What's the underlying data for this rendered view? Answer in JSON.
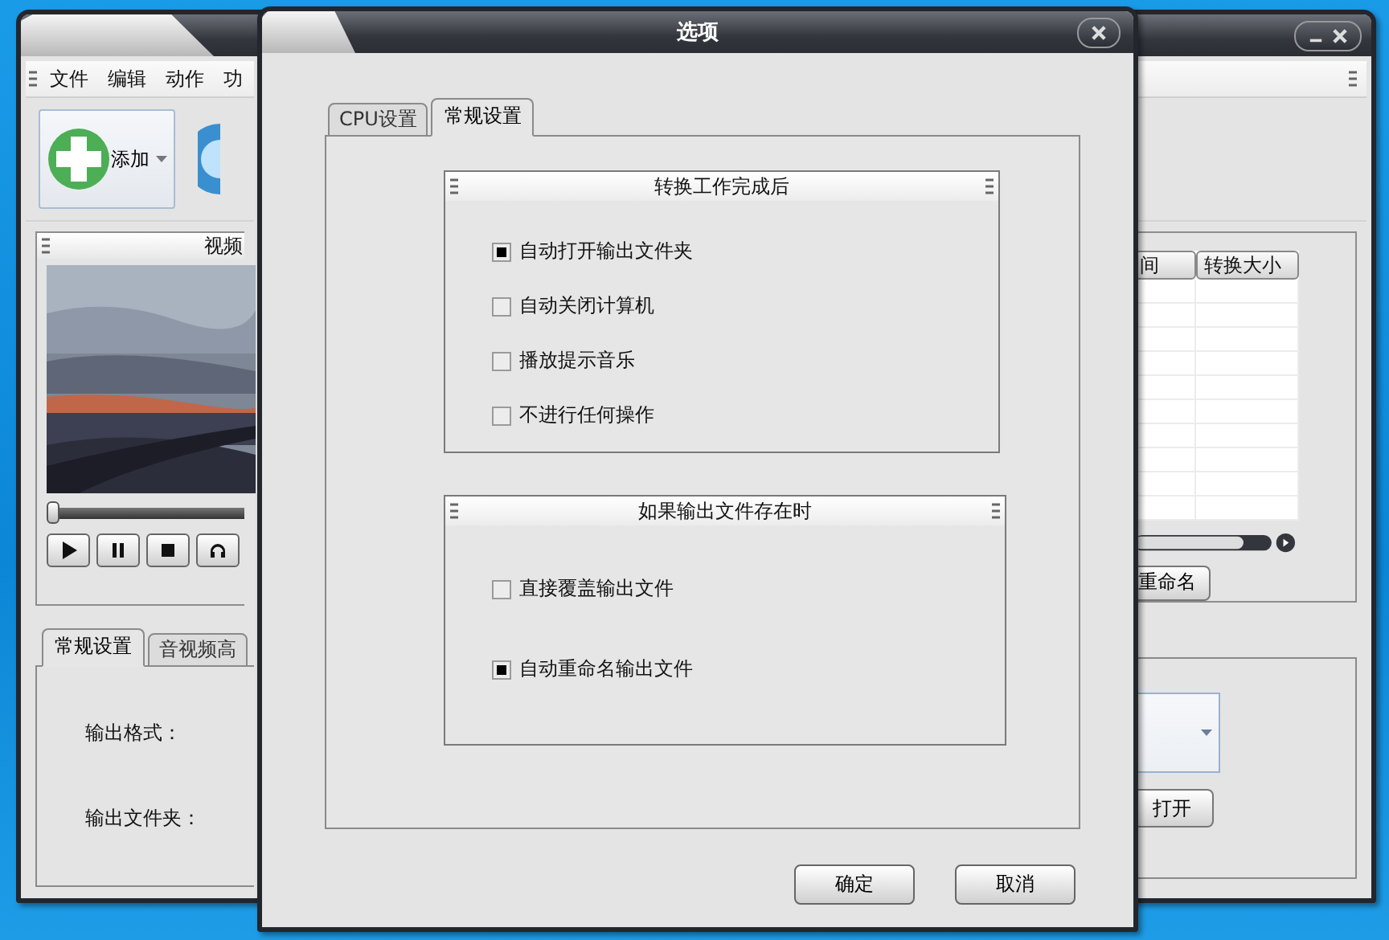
{
  "main_window": {
    "menu": [
      "文件",
      "编辑",
      "动作",
      "功"
    ],
    "add_button": "添加",
    "preview": {
      "title": "视频",
      "level": 0
    },
    "player_buttons": [
      {
        "kind": "play"
      },
      {
        "kind": "pause"
      },
      {
        "kind": "stop"
      },
      {
        "kind": "headphones"
      }
    ],
    "settings_tabs": [
      {
        "label": "常规设置",
        "selected": true
      },
      {
        "label": "音视频高",
        "selected": false
      }
    ],
    "fields": [
      {
        "label": "输出格式："
      },
      {
        "label": "输出文件夹："
      }
    ],
    "file_table": {
      "columns": [
        "间",
        "转换大小"
      ]
    },
    "rename_button": "重命名",
    "open_button": "打开"
  },
  "dialog": {
    "title": "选项",
    "tabs": [
      {
        "label": "CPU设置",
        "selected": false
      },
      {
        "label": "常规设置",
        "selected": true
      }
    ],
    "groups": [
      {
        "title": "转换工作完成后",
        "options": [
          {
            "label": "自动打开输出文件夹",
            "checked": true
          },
          {
            "label": "自动关闭计算机",
            "checked": false
          },
          {
            "label": "播放提示音乐",
            "checked": false
          },
          {
            "label": "不进行任何操作",
            "checked": false
          }
        ]
      },
      {
        "title": "如果输出文件存在时",
        "options": [
          {
            "label": "直接覆盖输出文件",
            "checked": false
          },
          {
            "label": "自动重命名输出文件",
            "checked": true
          }
        ]
      }
    ],
    "buttons": [
      "确定",
      "取消"
    ]
  }
}
